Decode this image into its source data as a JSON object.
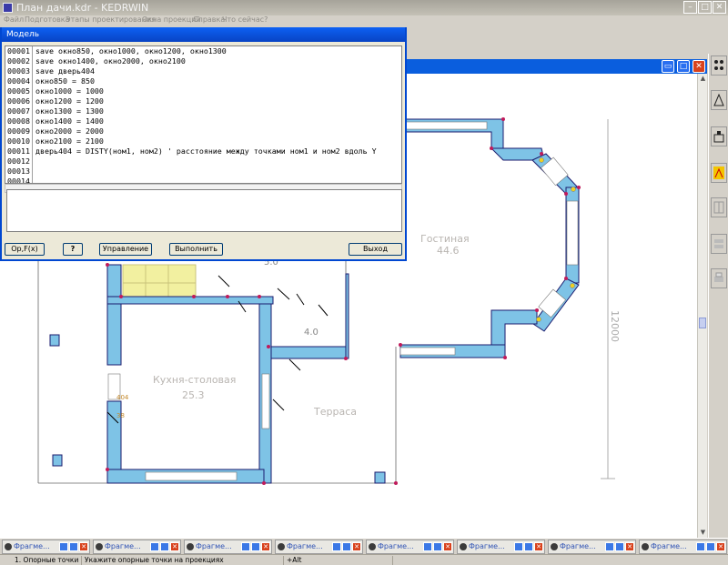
{
  "window": {
    "title": "План дачи.kdr - KEDRWIN",
    "min_glyph": "–",
    "max_glyph": "□",
    "close_glyph": "✕"
  },
  "menu": [
    "Файл",
    "Подготовка",
    "Этапы проектирования",
    "Окна проекций",
    "Справка",
    "Что сейчас?"
  ],
  "document": {
    "min_glyph": "▭",
    "max_glyph": "□",
    "close_glyph": "✕"
  },
  "dialog": {
    "title": "Модель",
    "line_numbers": [
      "00001",
      "00002",
      "00003",
      "00004",
      "00005",
      "00006",
      "00007",
      "00008",
      "00009",
      "00010",
      "00011",
      "00012",
      "00013",
      "00014"
    ],
    "code_lines": [
      "save окно850, окно1000, окно1200, окно1300",
      "save окно1400, окно2000, окно2100",
      "save дверь404",
      "окно850 = 850",
      "окно1000 = 1000",
      "окно1200 = 1200",
      "окно1300 = 1300",
      "окно1400 = 1400",
      "окно2000 = 2000",
      "окно2100 = 2100",
      "дверь404 = DISTY(ном1, ном2) ' расстояние между точками ном1 и ном2 вдоль Y",
      "",
      "",
      ""
    ],
    "buttons": {
      "formula": "Op,F(x)",
      "help": "?",
      "control": "Управление",
      "execute": "Выполнить",
      "exit": "Выход"
    }
  },
  "plan": {
    "rooms": [
      {
        "name": "Гостиная",
        "area": "44.6"
      },
      {
        "name": "Кухня-столовая",
        "area": "25.3"
      },
      {
        "name": "Терраса"
      }
    ],
    "dimension": "4.0",
    "partial_dimension": "5.0",
    "vertical_dimension": "12000",
    "labels": [
      "404",
      "38"
    ]
  },
  "taskbar": {
    "fragments": [
      "Фрагме...",
      "Фрагме...",
      "Фрагме...",
      "Фрагме...",
      "Фрагме...",
      "Фрагме...",
      "Фрагме...",
      "Фрагме..."
    ]
  },
  "status": {
    "mode": "1. Опорные точки",
    "hint": "Укажите опорные точки на проекциях",
    "key": "+Alt"
  },
  "colors": {
    "wall_fill": "#7ec3e6",
    "wall_stroke": "#1b1b6e",
    "stair_fill": "#f2f0a0",
    "accent": "#0a5ede"
  }
}
